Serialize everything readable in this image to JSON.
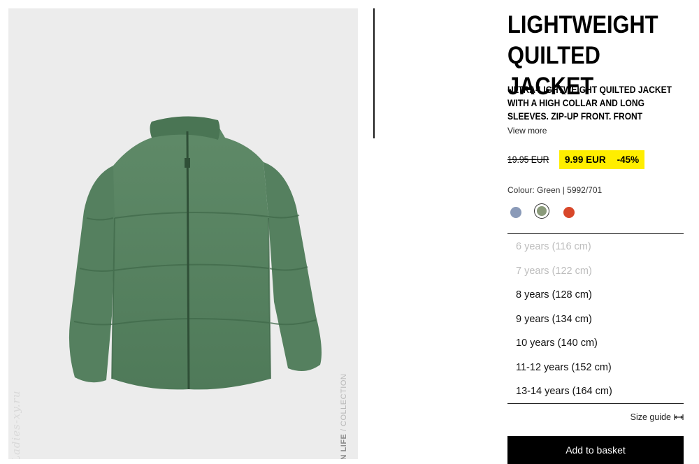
{
  "product": {
    "title": "LIGHTWEIGHT\nQUILTED JACKET",
    "description": "ULTRA-LIGHTWEIGHT QUILTED JACKET WITH A HIGH COLLAR AND LONG SLEEVES. ZIP-UP FRONT. FRONT",
    "view_more": "View more",
    "old_price": "19.95 EUR",
    "sale_price": "9.99 EUR",
    "discount": "-45%",
    "colour_line": "Colour: Green | 5992/701"
  },
  "colors": {
    "sale_highlight": "#ffee00",
    "swatches": [
      "#8a9ab8",
      "#8a9a7a",
      "#d8472a"
    ]
  },
  "sizes": [
    {
      "label": "6 years (116 cm)",
      "available": false
    },
    {
      "label": "7 years (122 cm)",
      "available": false
    },
    {
      "label": "8 years (128 cm)",
      "available": true
    },
    {
      "label": "9 years (134 cm)",
      "available": true
    },
    {
      "label": "10 years (140 cm)",
      "available": true
    },
    {
      "label": "11-12 years (152 cm)",
      "available": true
    },
    {
      "label": "13-14 years (164 cm)",
      "available": true
    }
  ],
  "size_guide": "Size guide",
  "add_to_basket": "Add to basket",
  "image": {
    "vertical_caption_bold": "IN LIFE",
    "vertical_caption_rest": " / COLLECTION",
    "watermark": "Ladies-xy.ru"
  }
}
